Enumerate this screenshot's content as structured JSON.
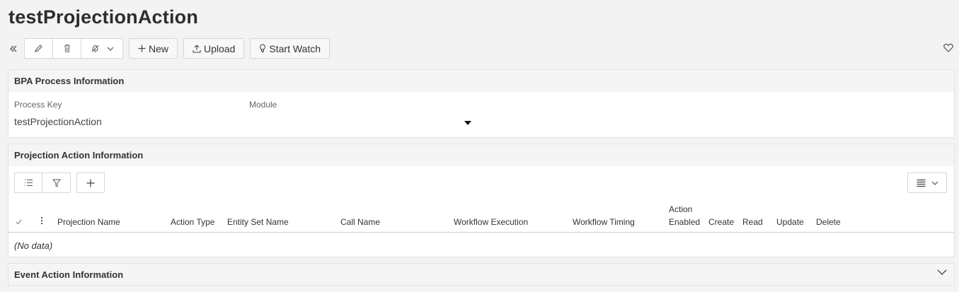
{
  "page": {
    "title": "testProjectionAction"
  },
  "toolbar": {
    "new_label": "New",
    "upload_label": "Upload",
    "start_watch_label": "Start Watch"
  },
  "bpa_panel": {
    "title": "BPA Process Information",
    "process_key_label": "Process Key",
    "process_key_value": "testProjectionAction",
    "module_label": "Module",
    "module_value": ""
  },
  "projection_panel": {
    "title": "Projection Action Information",
    "columns": [
      "Projection Name",
      "Action Type",
      "Entity Set Name",
      "Call Name",
      "Workflow Execution",
      "Workflow Timing",
      "Enabled",
      "Create",
      "Read",
      "Update",
      "Delete"
    ],
    "enabled_col_top": "Action",
    "empty_text": "(No data)"
  },
  "event_panel": {
    "title": "Event Action Information"
  },
  "icons": {
    "collapse": "double-chevron-left-icon",
    "edit": "pencil-icon",
    "delete": "trash-icon",
    "approve": "bell-icon",
    "favorite": "heart-icon"
  }
}
